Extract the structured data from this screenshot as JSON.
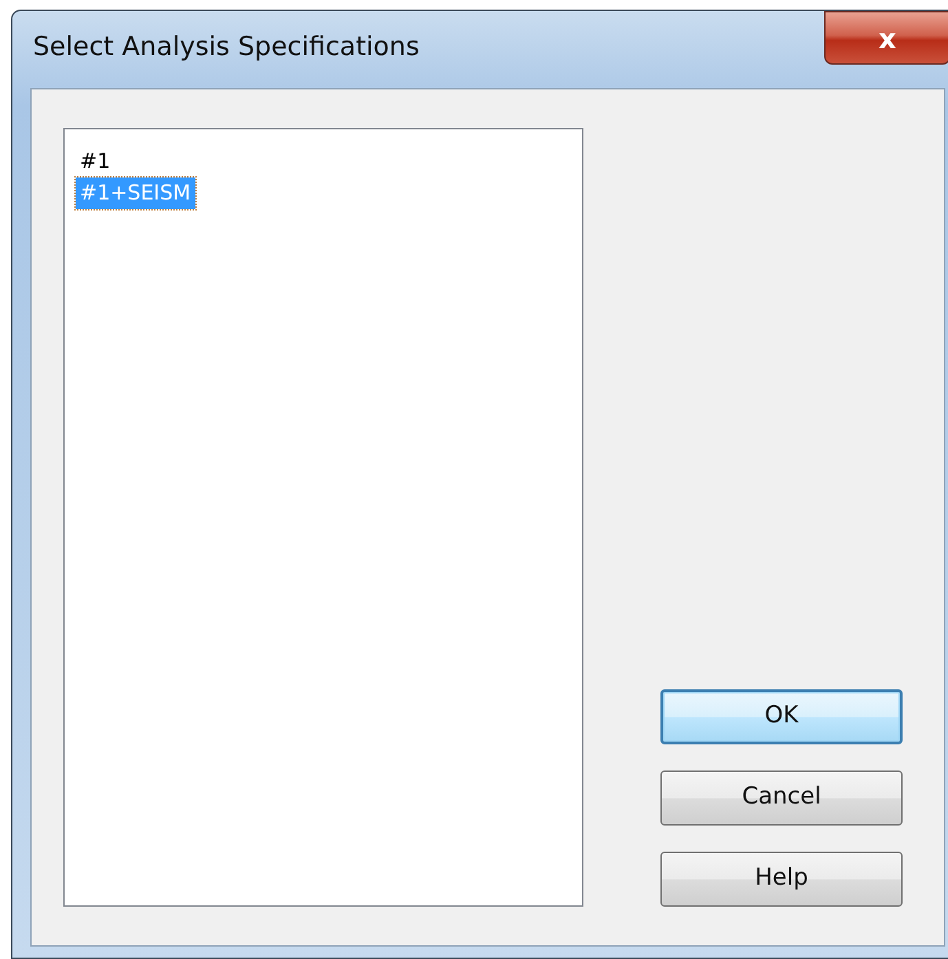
{
  "window": {
    "title": "Select Analysis Specifications",
    "close_label": "x"
  },
  "list": {
    "items": [
      {
        "label": "#1",
        "selected": false
      },
      {
        "label": "#1+SEISM",
        "selected": true
      }
    ]
  },
  "buttons": [
    {
      "label": "OK",
      "default": true
    },
    {
      "label": "Cancel",
      "default": false
    },
    {
      "label": "Help",
      "default": false
    }
  ]
}
